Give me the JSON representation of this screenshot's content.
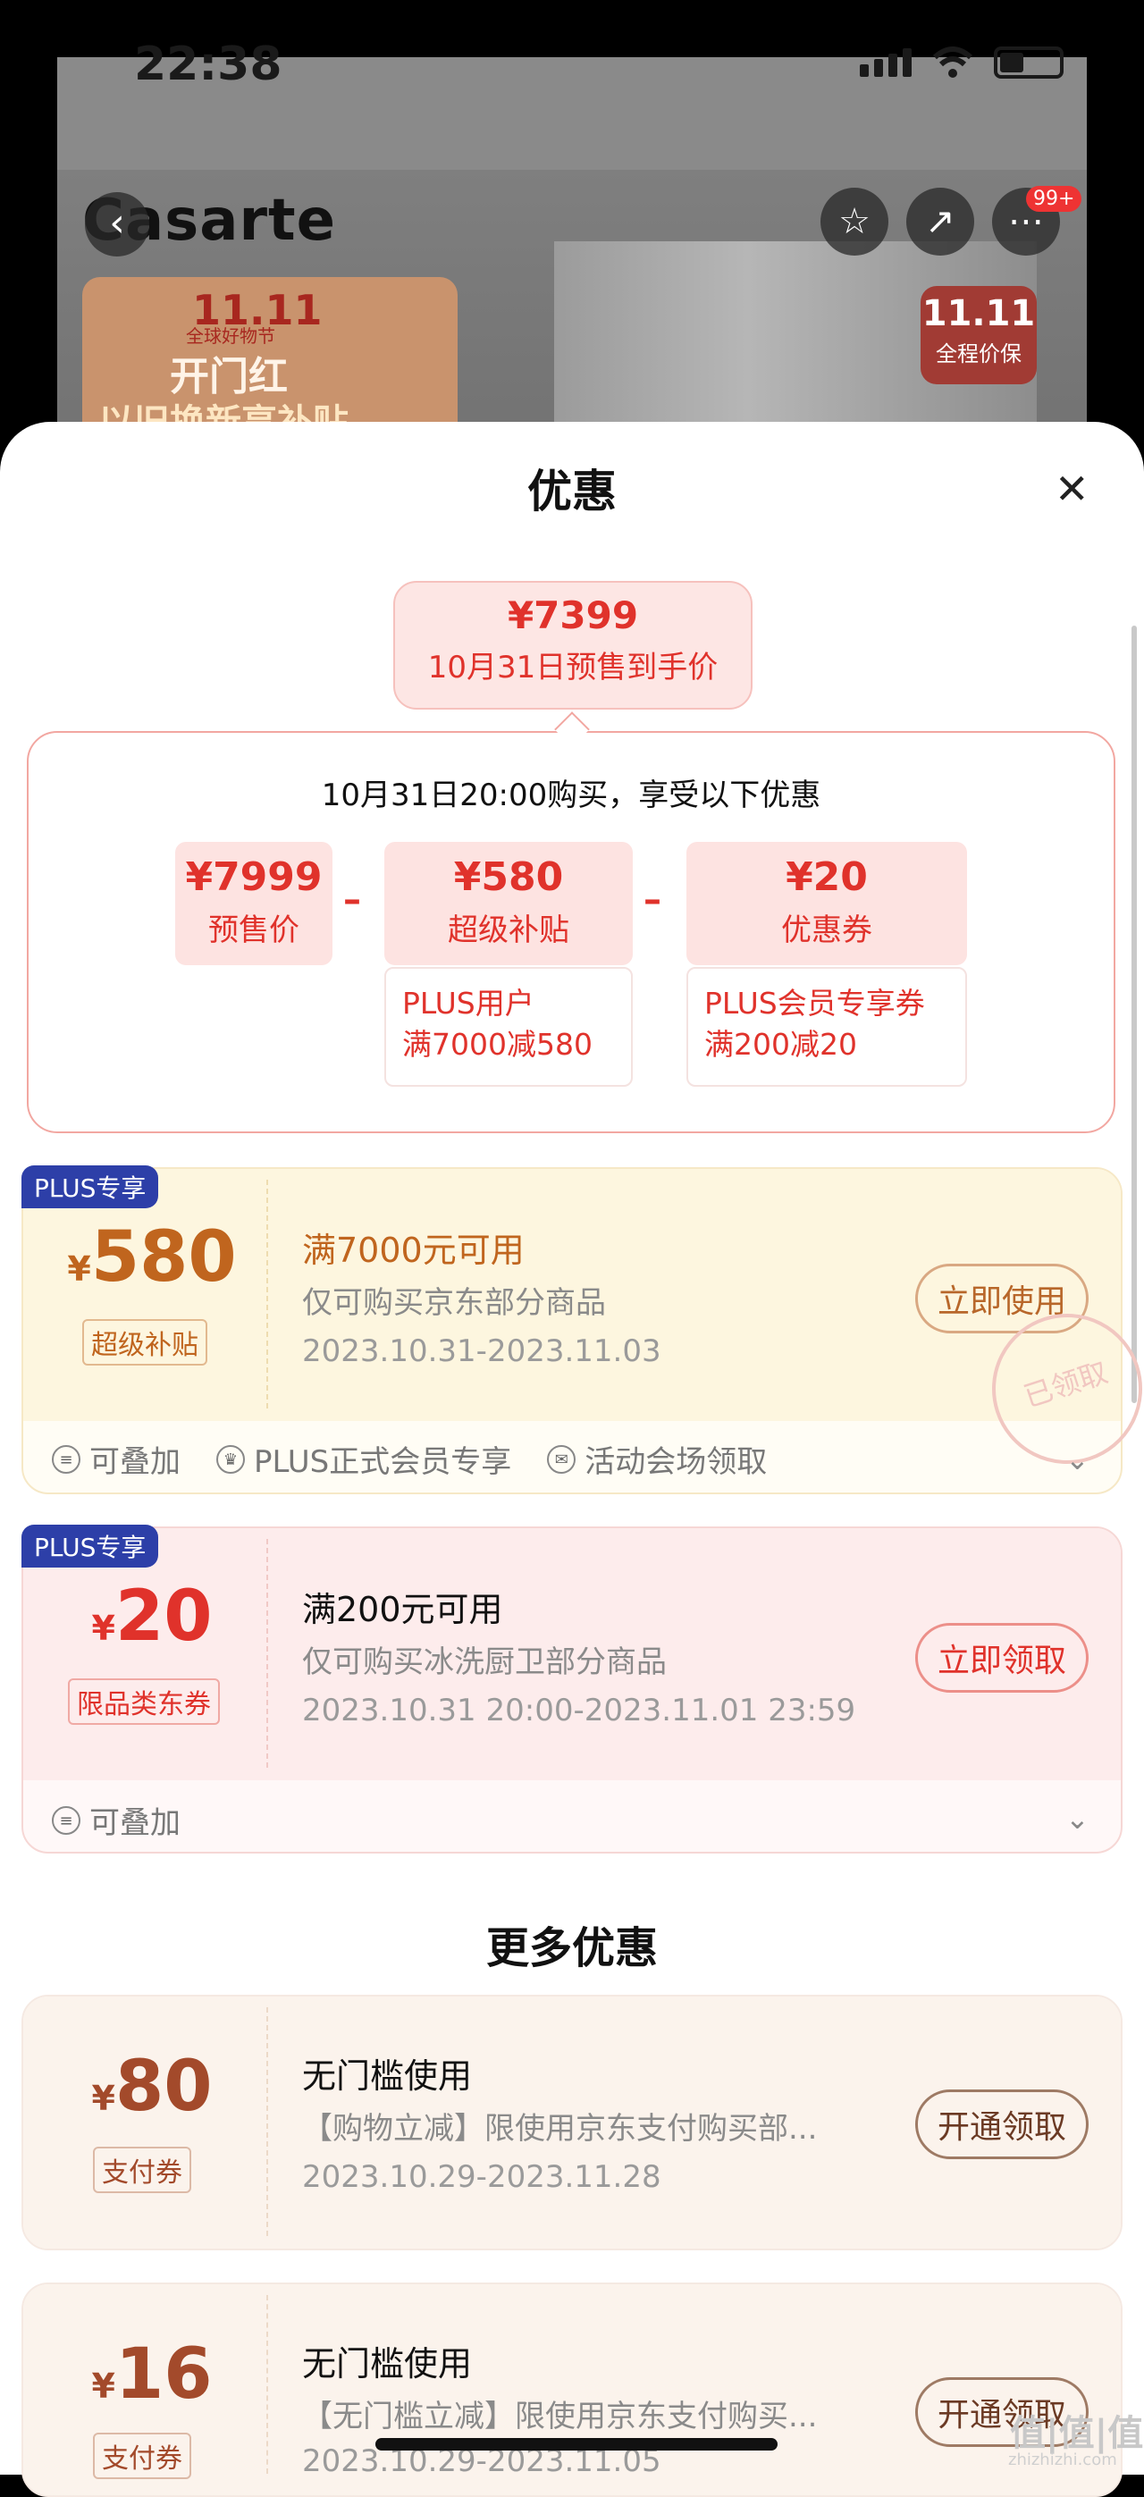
{
  "status": {
    "time": "22:38"
  },
  "background": {
    "brand": "Casarte",
    "badge": "99+",
    "promo_111": "11.11",
    "promo_sub": "全球好物节",
    "promo_main": "开门红",
    "promo_bottom": "以旧换新享补贴",
    "price_tag_top": "11.11",
    "price_tag_bottom": "全程价保"
  },
  "sheet": {
    "title": "优惠",
    "final": {
      "price": "¥7399",
      "label": "10月31日预售到手价"
    },
    "calc_title": "10月31日20:00购买，享受以下优惠",
    "items": [
      {
        "amount": "¥7999",
        "label": "预售价"
      },
      {
        "amount": "¥580",
        "label": "超级补贴",
        "detail1": "PLUS用户",
        "detail2": "满7000减580"
      },
      {
        "amount": "¥20",
        "label": "优惠券",
        "detail1": "PLUS会员专享券",
        "detail2": "满200减20"
      }
    ],
    "minus_sign": "–"
  },
  "coupons": [
    {
      "tag": "PLUS专享",
      "currency": "¥",
      "amount": "580",
      "type": "超级补贴",
      "title": "满7000元可用",
      "desc": "仅可购买京东部分商品",
      "date": "2023.10.31-2023.11.03",
      "button": "立即使用",
      "stamp": "已领取",
      "perks": [
        "可叠加",
        "PLUS正式会员专享",
        "活动会场领取"
      ]
    },
    {
      "tag": "PLUS专享",
      "currency": "¥",
      "amount": "20",
      "type": "限品类东券",
      "title": "满200元可用",
      "desc": "仅可购买冰洗厨卫部分商品",
      "date": "2023.10.31 20:00-2023.11.01 23:59",
      "button": "立即领取",
      "perks": [
        "可叠加"
      ]
    }
  ],
  "more": {
    "title": "更多优惠",
    "coupons": [
      {
        "currency": "¥",
        "amount": "80",
        "type": "支付券",
        "title": "无门槛使用",
        "desc": "【购物立减】限使用京东支付购买部...",
        "date": "2023.10.29-2023.11.28",
        "button": "开通领取"
      },
      {
        "currency": "¥",
        "amount": "16",
        "type": "支付券",
        "title": "无门槛使用",
        "desc": "【无门槛立减】限使用京东支付购买...",
        "date": "2023.10.29-2023.11.05",
        "button": "开通领取"
      }
    ]
  },
  "watermark": {
    "main": "值|值|值",
    "sub": "zhizhizhi.com"
  },
  "colors": {
    "accent_red": "#e0322b",
    "gold": "#b8672a",
    "plus_blue": "#2d3fa8"
  }
}
